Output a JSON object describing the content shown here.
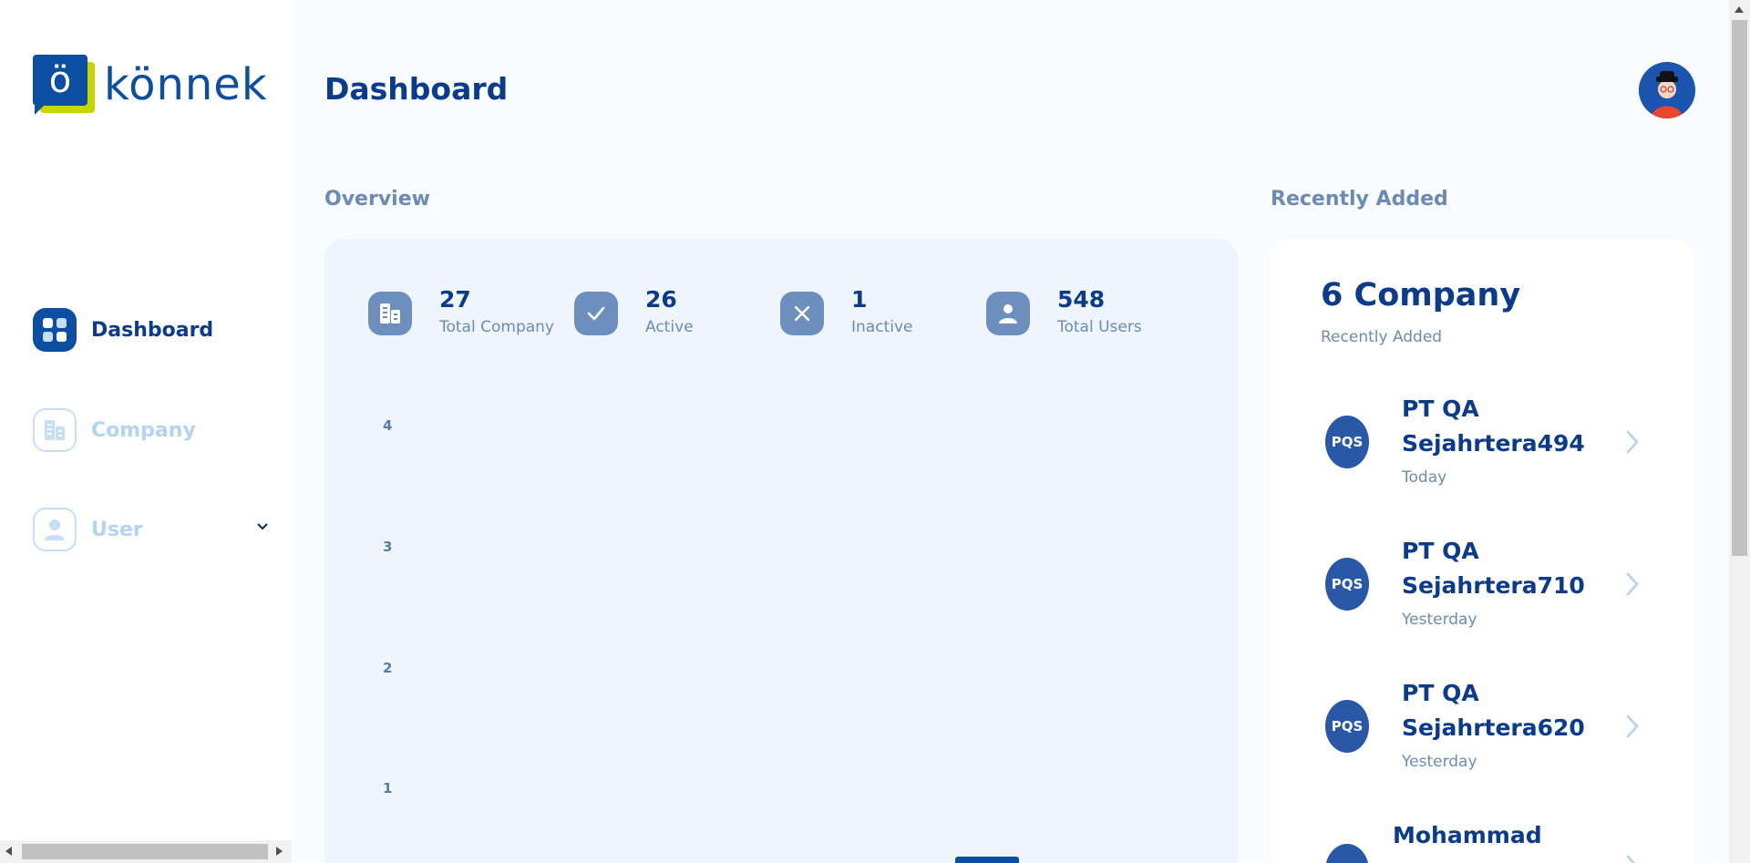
{
  "app": {
    "logo_text": "könnek",
    "logo_mark": "ö"
  },
  "sidebar": {
    "items": [
      {
        "label": "Dashboard",
        "icon": "dashboard-grid-icon",
        "active": true
      },
      {
        "label": "Company",
        "icon": "company-building-icon",
        "active": false
      },
      {
        "label": "User",
        "icon": "user-icon",
        "active": false,
        "expandable": true
      }
    ]
  },
  "header": {
    "title": "Dashboard",
    "avatar_icon": "user-avatar-icon"
  },
  "overview": {
    "section_label": "Overview",
    "stats": [
      {
        "value": "27",
        "label": "Total Company",
        "icon": "company-building-icon"
      },
      {
        "value": "26",
        "label": "Active",
        "icon": "check-icon"
      },
      {
        "value": "1",
        "label": "Inactive",
        "icon": "close-icon"
      },
      {
        "value": "548",
        "label": "Total Users",
        "icon": "user-icon"
      }
    ]
  },
  "chart_data": {
    "type": "bar",
    "y_ticks": [
      "4",
      "3",
      "2",
      "1"
    ],
    "ylim": [
      0,
      4
    ],
    "grid": false,
    "legend": "none",
    "bar_color": "#0b4ea2"
  },
  "recent": {
    "section_label": "Recently Added",
    "count_title": "6 Company",
    "subtitle": "Recently Added",
    "items": [
      {
        "initials": "PQS",
        "name": "PT QA Sejahrtera494",
        "time": "Today"
      },
      {
        "initials": "PQS",
        "name": "PT QA Sejahrtera710",
        "time": "Yesterday"
      },
      {
        "initials": "PQS",
        "name": "PT QA Sejahrtera620",
        "time": "Yesterday"
      },
      {
        "initials": "",
        "name": "Mohammad",
        "time": ""
      }
    ]
  },
  "colors": {
    "primary": "#0b3b8c",
    "accent": "#0b4ea2",
    "muted": "#6b8bb5",
    "inactive_nav": "#b3d3f3",
    "logo_green": "#c8d400"
  }
}
